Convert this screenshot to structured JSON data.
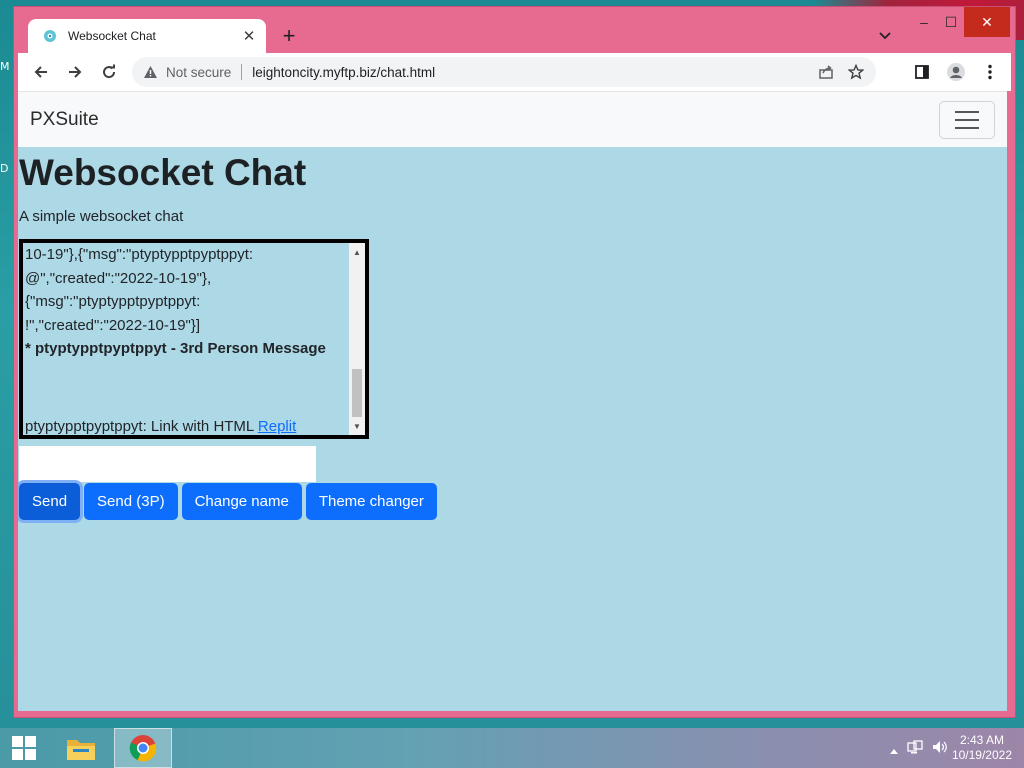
{
  "desktop": {
    "left_labels": [
      "M",
      "D"
    ]
  },
  "browser": {
    "tab": {
      "title": "Websocket Chat",
      "favicon": "globe-icon",
      "close_symbol": "✕"
    },
    "new_tab_symbol": "+",
    "window_controls": {
      "minimize": "–",
      "maximize": "☐",
      "close": "✕"
    },
    "address": {
      "security_label": "Not secure",
      "url": "leightoncity.myftp.biz/chat.html"
    }
  },
  "page": {
    "navbar": {
      "brand": "PXSuite"
    },
    "title": "Websocket Chat",
    "subtitle": "A simple websocket chat",
    "chat": {
      "lines": [
        "10-19\"},{\"msg\":\"ptyptypptpyptppyt:",
        "@\",\"created\":\"2022-10-19\"},",
        "{\"msg\":\"ptyptypptpyptppyt:",
        "!\",\"created\":\"2022-10-19\"}]"
      ],
      "third_person": "* ptyptypptpyptppyt - 3rd Person Message",
      "link_prefix": "ptyptypptpyptppyt: Link with HTML",
      "link_text": "Replit"
    },
    "input": {
      "value": "",
      "placeholder": ""
    },
    "buttons": {
      "send": "Send",
      "send_3p": "Send (3P)",
      "change_name": "Change name",
      "theme_changer": "Theme changer"
    }
  },
  "taskbar": {
    "time": "2:43 AM",
    "date": "10/19/2022"
  },
  "colors": {
    "page_background": "#add8e6",
    "button": "#0d6efd",
    "window_frame": "#e76b91",
    "link": "#0d6efd"
  }
}
